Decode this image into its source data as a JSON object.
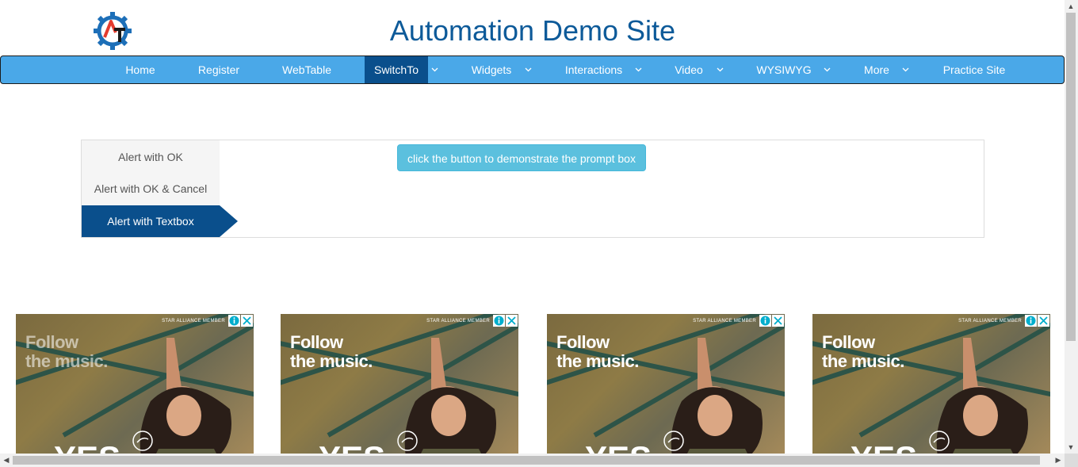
{
  "header": {
    "title": "Automation Demo Site",
    "logo_icon": "gear-at-logo-icon"
  },
  "nav": {
    "items": [
      {
        "label": "Home",
        "dropdown": false,
        "active": false
      },
      {
        "label": "Register",
        "dropdown": false,
        "active": false
      },
      {
        "label": "WebTable",
        "dropdown": false,
        "active": false
      },
      {
        "label": "SwitchTo",
        "dropdown": true,
        "active": true
      },
      {
        "label": "Widgets",
        "dropdown": true,
        "active": false
      },
      {
        "label": "Interactions",
        "dropdown": true,
        "active": false
      },
      {
        "label": "Video",
        "dropdown": true,
        "active": false
      },
      {
        "label": "WYSIWYG",
        "dropdown": true,
        "active": false
      },
      {
        "label": "More",
        "dropdown": true,
        "active": false
      },
      {
        "label": "Practice Site",
        "dropdown": false,
        "active": false
      }
    ]
  },
  "tabs": {
    "items": [
      {
        "label": "Alert with OK",
        "active": false
      },
      {
        "label": "Alert with OK & Cancel",
        "active": false
      },
      {
        "label": "Alert with Textbox",
        "active": true
      }
    ],
    "button_label": "click the button to demonstrate the prompt box"
  },
  "ads": [
    {
      "headline_line1": "Follow",
      "headline_line2": "the music.",
      "tag": "STAR ALLIANCE MEMBER",
      "bigtext": "YES"
    },
    {
      "headline_line1": "Follow",
      "headline_line2": "the music.",
      "tag": "STAR ALLIANCE MEMBER",
      "bigtext": "YES"
    },
    {
      "headline_line1": "Follow",
      "headline_line2": "the music.",
      "tag": "STAR ALLIANCE MEMBER",
      "bigtext": "YES"
    },
    {
      "headline_line1": "Follow",
      "headline_line2": "the music.",
      "tag": "STAR ALLIANCE MEMBER",
      "bigtext": "YES"
    }
  ],
  "colors": {
    "title": "#0d5a99",
    "navbar": "#4aa8e8",
    "nav_active": "#0a4f8c",
    "button": "#5bc0de"
  }
}
